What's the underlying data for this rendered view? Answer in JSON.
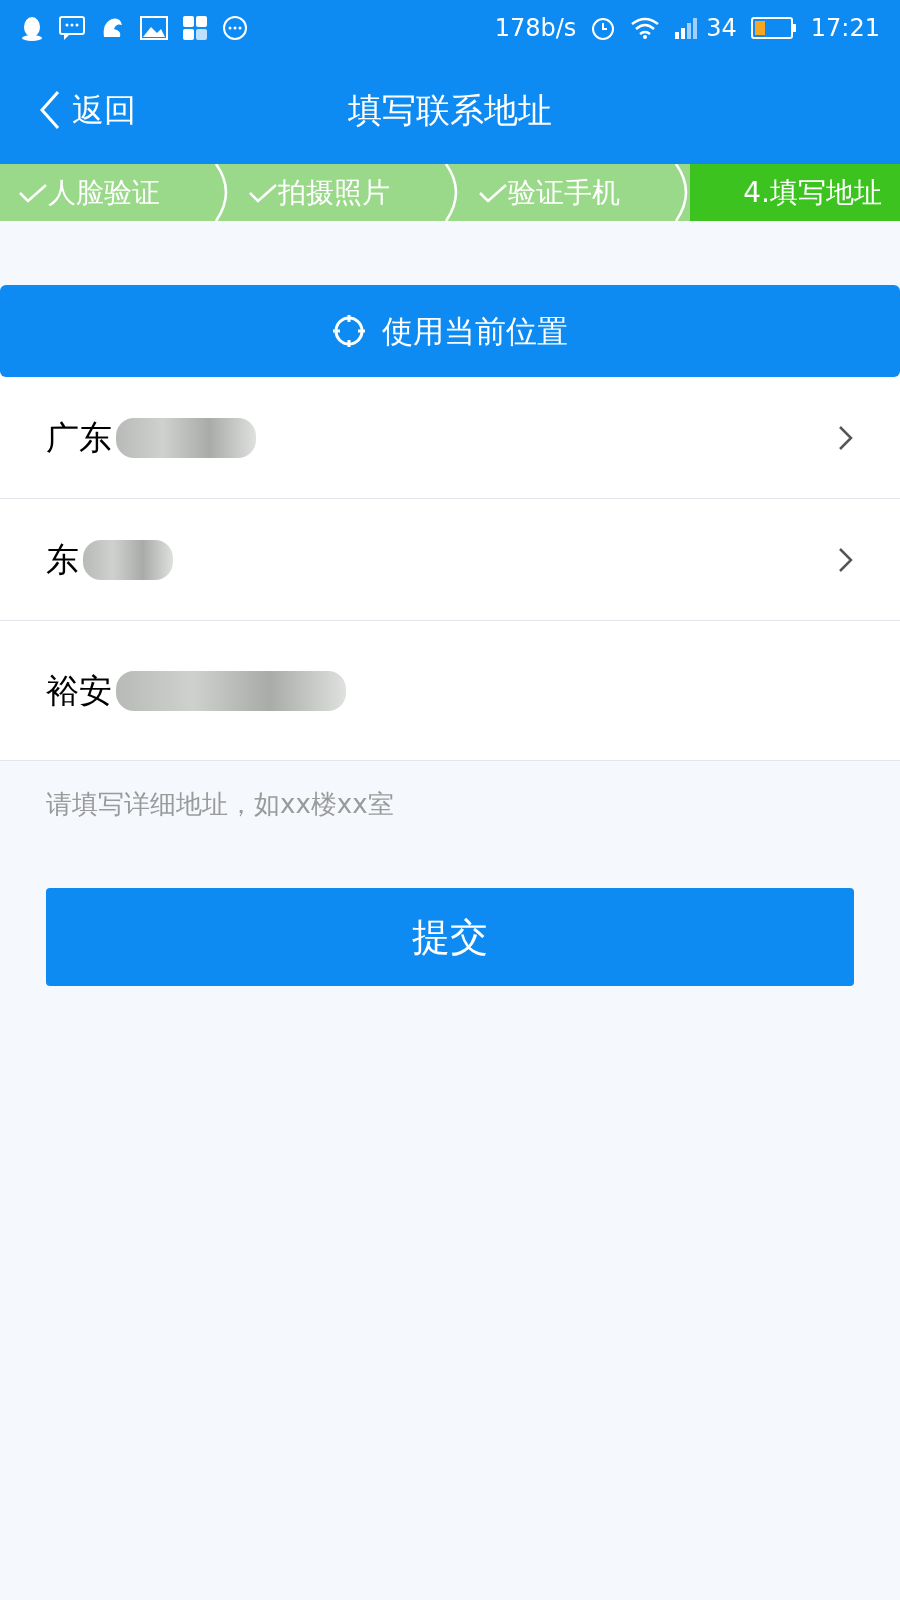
{
  "status_bar": {
    "speed": "178b/s",
    "signal": "34",
    "time": "17:21"
  },
  "header": {
    "back": "返回",
    "title": "填写联系地址"
  },
  "steps": [
    {
      "label": "人脸验证",
      "done": true,
      "selected": false
    },
    {
      "label": "拍摄照片",
      "done": true,
      "selected": false
    },
    {
      "label": "验证手机",
      "done": true,
      "selected": false
    },
    {
      "label": "4.填写地址",
      "done": false,
      "selected": true
    }
  ],
  "locate_button": "使用当前位置",
  "rows": [
    {
      "kind": "select",
      "value": "广东",
      "redacted": true
    },
    {
      "kind": "select",
      "value": "东",
      "redacted": true
    },
    {
      "kind": "text",
      "value": "裕安",
      "redacted": true
    }
  ],
  "detail_field": {
    "placeholder": "请填写详细地址，如xx楼xx室"
  },
  "submit": "提交"
}
